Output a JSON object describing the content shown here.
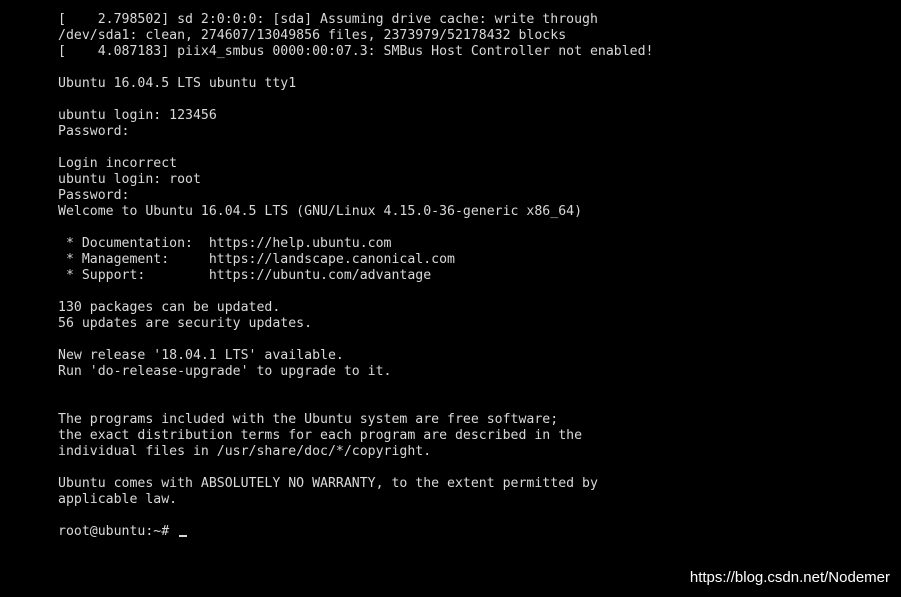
{
  "terminal": {
    "lines": [
      "[    2.798502] sd 2:0:0:0: [sda] Assuming drive cache: write through",
      "/dev/sda1: clean, 274607/13049856 files, 2373979/52178432 blocks",
      "[    4.087183] piix4_smbus 0000:00:07.3: SMBus Host Controller not enabled!",
      "",
      "Ubuntu 16.04.5 LTS ubuntu tty1",
      "",
      "ubuntu login: 123456",
      "Password:",
      "",
      "Login incorrect",
      "ubuntu login: root",
      "Password:",
      "Welcome to Ubuntu 16.04.5 LTS (GNU/Linux 4.15.0-36-generic x86_64)",
      "",
      " * Documentation:  https://help.ubuntu.com",
      " * Management:     https://landscape.canonical.com",
      " * Support:        https://ubuntu.com/advantage",
      "",
      "130 packages can be updated.",
      "56 updates are security updates.",
      "",
      "New release '18.04.1 LTS' available.",
      "Run 'do-release-upgrade' to upgrade to it.",
      "",
      "",
      "The programs included with the Ubuntu system are free software;",
      "the exact distribution terms for each program are described in the",
      "individual files in /usr/share/doc/*/copyright.",
      "",
      "Ubuntu comes with ABSOLUTELY NO WARRANTY, to the extent permitted by",
      "applicable law.",
      ""
    ],
    "prompt": "root@ubuntu:~# "
  },
  "watermark": "https://blog.csdn.net/Nodemer",
  "colors": {
    "background": "#000000",
    "text": "#d9d9d9",
    "watermark": "#ffffff"
  }
}
